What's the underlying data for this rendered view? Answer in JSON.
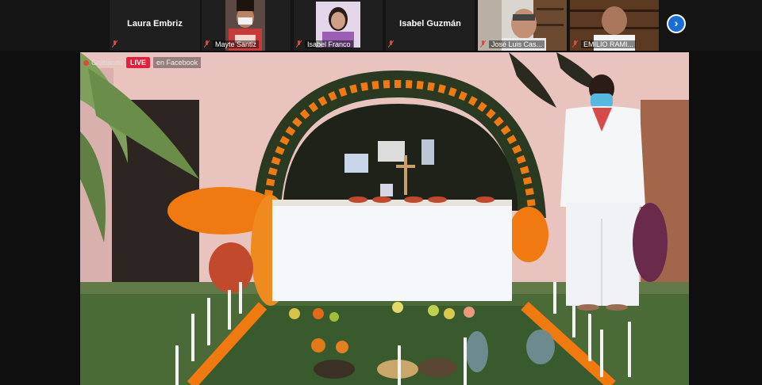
{
  "participants": [
    {
      "name": "Laura Embriz",
      "type": "name-only"
    },
    {
      "name": "Mayte Santiz",
      "type": "video"
    },
    {
      "name": "Isabel Franco",
      "type": "video"
    },
    {
      "name": "Isabel Guzmán",
      "type": "name-only"
    },
    {
      "name": "José Luis Cas...",
      "type": "video"
    },
    {
      "name": "EMILIO RAMI...",
      "type": "video"
    }
  ],
  "navigation": {
    "next_icon": "chevron-right-icon"
  },
  "stream": {
    "recording_label": "Grabando",
    "live_label": "LIVE",
    "platform_label": "en Facebook"
  },
  "colors": {
    "live_badge": "#e41e3f",
    "mic_muted": "#e2473e",
    "nav_button": "#1b6dd6",
    "marigold": "#f07a10"
  }
}
